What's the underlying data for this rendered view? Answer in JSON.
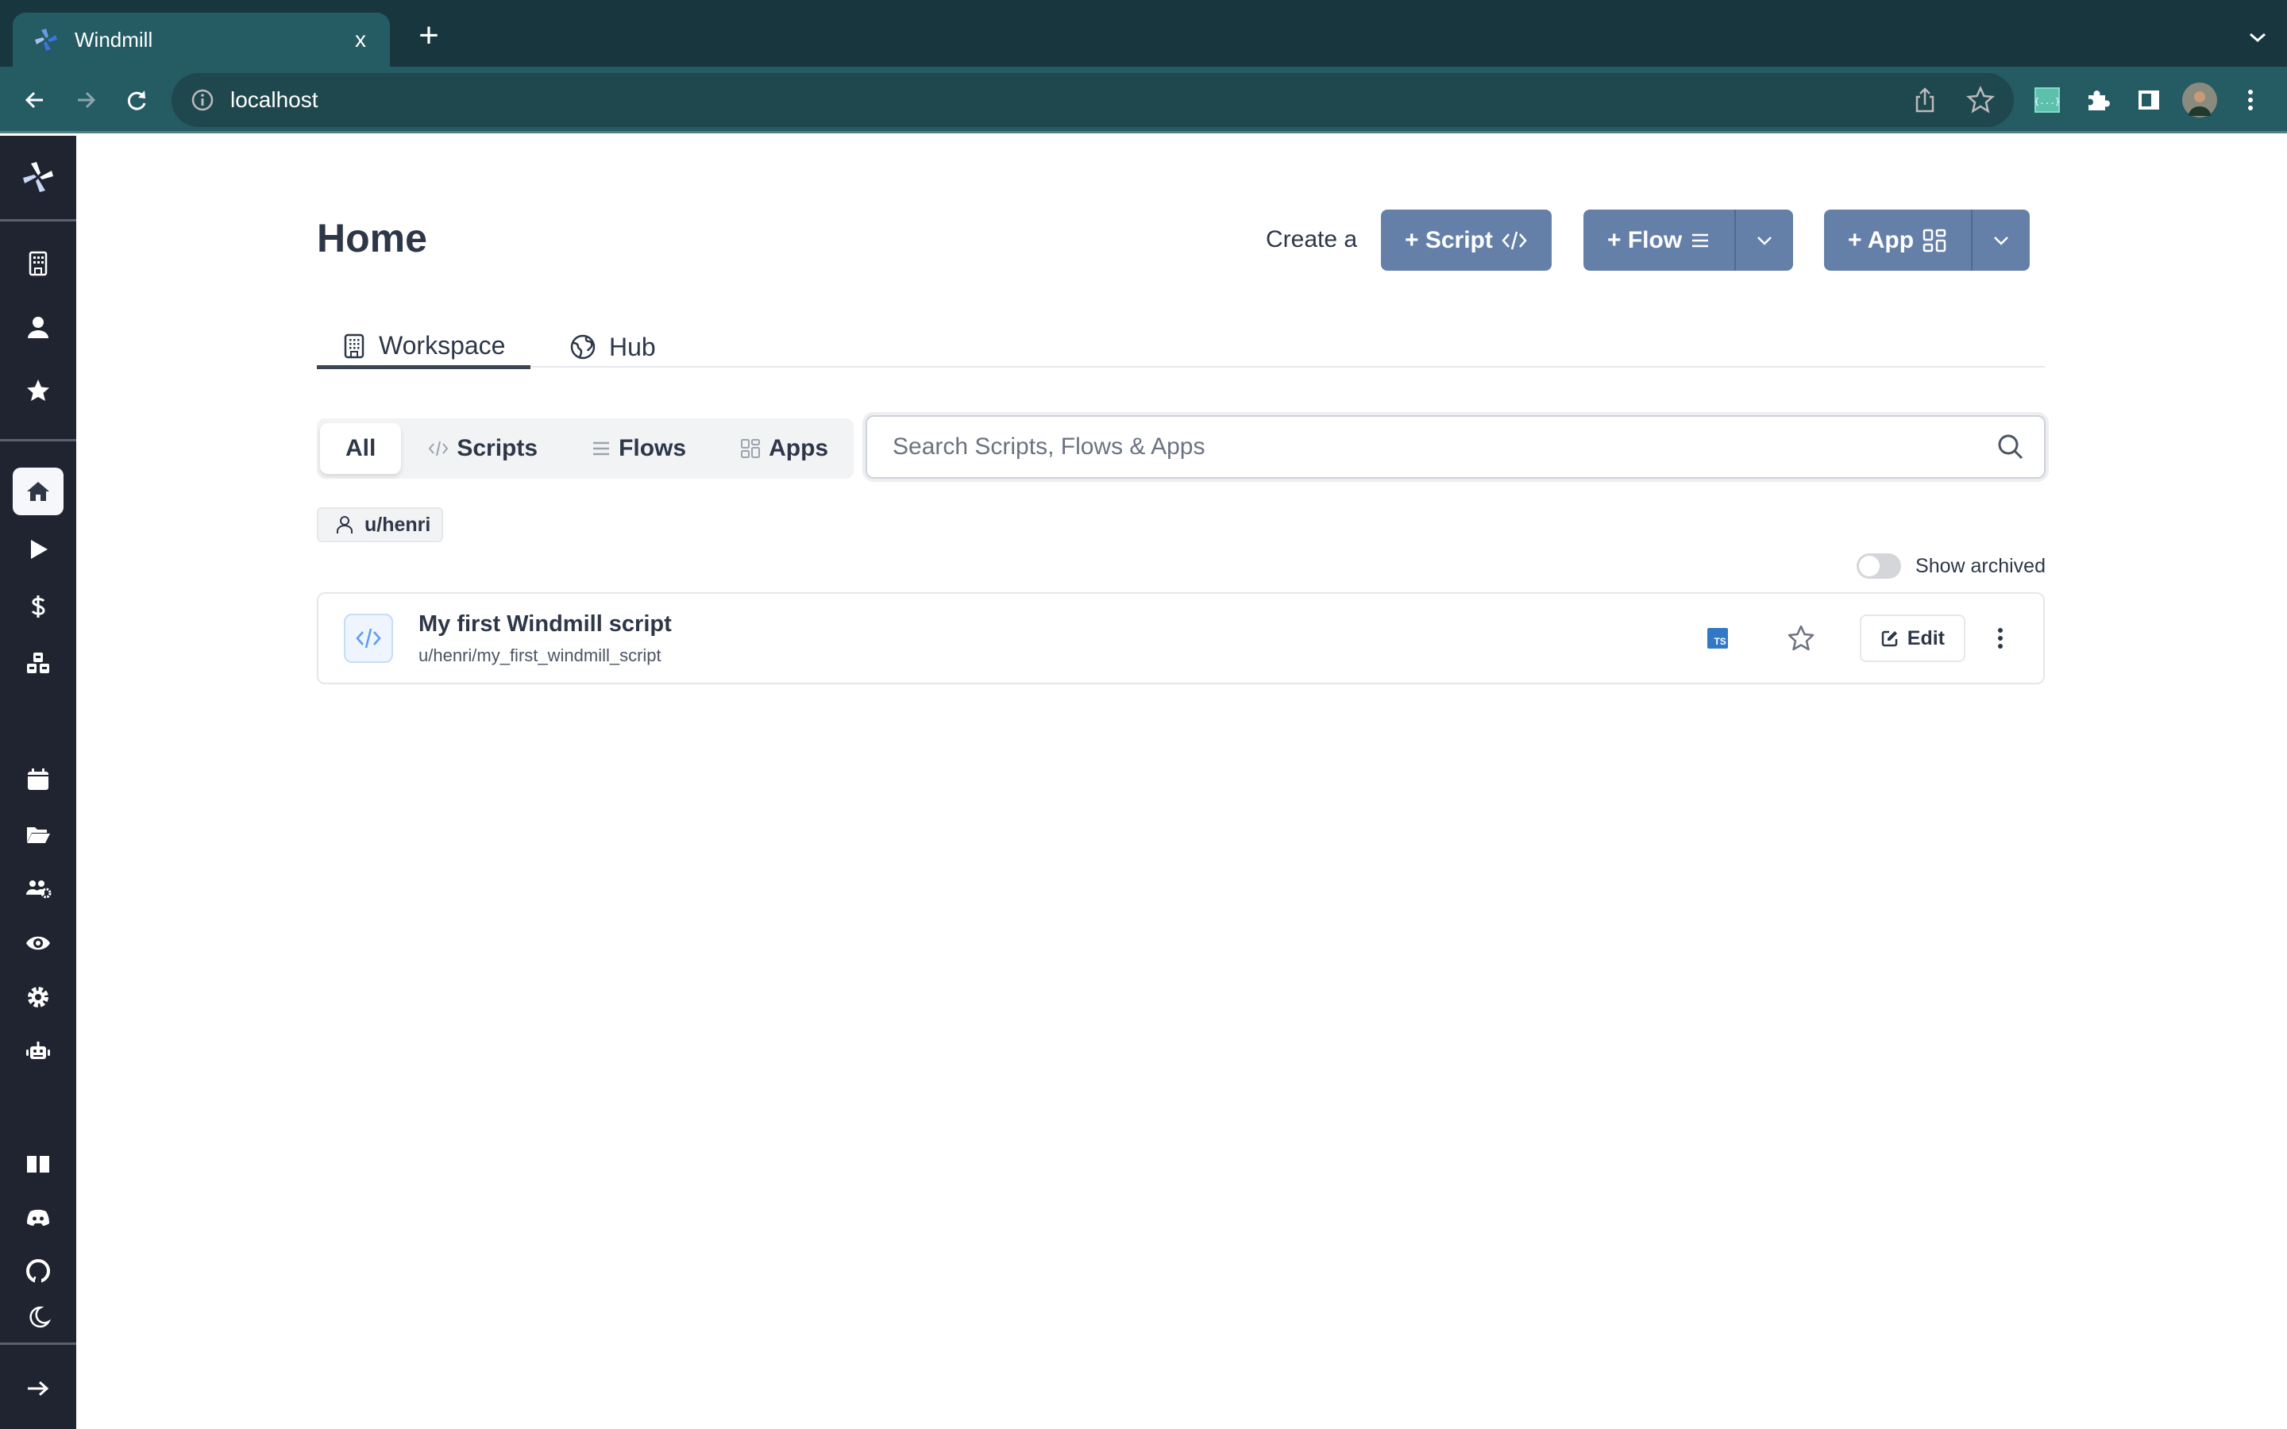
{
  "browser": {
    "tab_title": "Windmill",
    "close_glyph": "x",
    "new_tab_glyph": "+",
    "url": "localhost",
    "icons": {
      "favicon": "windmill-logo-icon",
      "back": "arrow-left-icon",
      "forward": "arrow-right-icon",
      "reload": "reload-icon",
      "site_info": "info-icon",
      "share": "share-icon",
      "bookmark": "star-outline-icon",
      "json_extension": "json-extension-icon",
      "extensions": "puzzle-icon",
      "side_panel": "side-panel-icon",
      "profile": "profile-avatar",
      "menu": "kebab-menu-icon",
      "tab_list": "chevron-down-icon"
    }
  },
  "sidebar": {
    "logo": "windmill-logo-icon",
    "top_items": [
      {
        "name": "workspace",
        "icon": "building-icon"
      },
      {
        "name": "user",
        "icon": "user-icon"
      },
      {
        "name": "favorites",
        "icon": "star-icon"
      }
    ],
    "main_items": [
      {
        "name": "home",
        "icon": "home-icon",
        "active": true
      },
      {
        "name": "runs",
        "icon": "play-icon"
      },
      {
        "name": "variables",
        "icon": "dollar-icon"
      },
      {
        "name": "resources",
        "icon": "cubes-icon"
      }
    ],
    "admin_items": [
      {
        "name": "schedules",
        "icon": "calendar-icon"
      },
      {
        "name": "folders",
        "icon": "folder-open-icon"
      },
      {
        "name": "groups",
        "icon": "users-cog-icon"
      },
      {
        "name": "audit-logs",
        "icon": "eye-icon"
      },
      {
        "name": "workspace-settings",
        "icon": "gear-icon"
      },
      {
        "name": "workers",
        "icon": "robot-icon"
      }
    ],
    "bottom_items": [
      {
        "name": "docs",
        "icon": "book-icon"
      },
      {
        "name": "discord",
        "icon": "discord-icon"
      },
      {
        "name": "github",
        "icon": "github-icon"
      },
      {
        "name": "dark-mode",
        "icon": "moon-icon"
      }
    ],
    "expand": {
      "name": "expand-sidebar",
      "icon": "arrow-right-icon"
    }
  },
  "header": {
    "title": "Home",
    "create_label": "Create a",
    "buttons": {
      "script": "+ Script",
      "flow": "+ Flow",
      "app": "+ App"
    }
  },
  "tabs": [
    {
      "label": "Workspace",
      "icon": "building-icon",
      "active": true
    },
    {
      "label": "Hub",
      "icon": "globe-icon",
      "active": false
    }
  ],
  "filters": [
    {
      "label": "All",
      "active": true
    },
    {
      "label": "Scripts",
      "icon": "code-icon"
    },
    {
      "label": "Flows",
      "icon": "bars-icon"
    },
    {
      "label": "Apps",
      "icon": "grid-icon"
    }
  ],
  "search": {
    "placeholder": "Search Scripts, Flows & Apps",
    "value": ""
  },
  "owner_filter": {
    "label": "u/henri"
  },
  "show_archived": {
    "label": "Show archived",
    "checked": false
  },
  "items": [
    {
      "title": "My first Windmill script",
      "path": "u/henri/my_first_windmill_script",
      "language_badge": "TS",
      "favorite": false,
      "edit_label": "Edit"
    }
  ],
  "colors": {
    "accent": "#6580a8",
    "sidebar_bg": "#1f2430",
    "chrome_tabstrip": "#18363e",
    "chrome_toolbar": "#255b63",
    "text": "#2d3748",
    "ts_blue": "#3178c6"
  }
}
